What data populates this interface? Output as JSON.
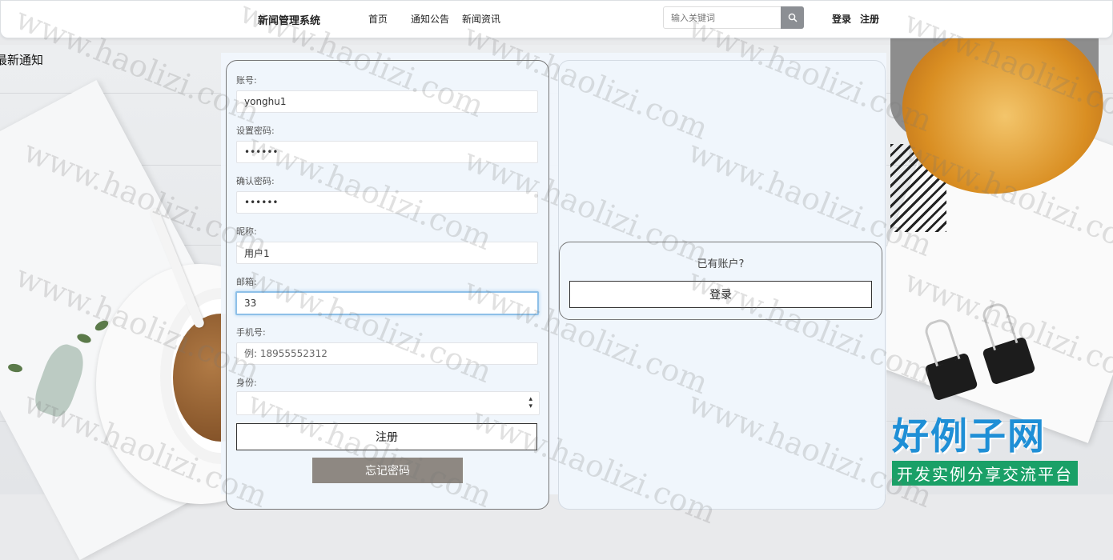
{
  "navbar": {
    "title": "新闻管理系统",
    "links": [
      "首页",
      "通知公告",
      "新闻资讯"
    ],
    "search_placeholder": "输入关键词",
    "login": "登录",
    "register": "注册"
  },
  "ticker": "最新通知",
  "form": {
    "account_label": "账号:",
    "account_value": "yonghu1",
    "password_label": "设置密码:",
    "password_value": "••••••",
    "confirm_label": "确认密码:",
    "confirm_value": "••••••",
    "nickname_label": "昵称:",
    "nickname_value": "用户1",
    "email_label": "邮箱:",
    "email_value": "33",
    "phone_label": "手机号:",
    "phone_placeholder": "例: 18955552312",
    "role_label": "身份:",
    "register_button": "注册",
    "forgot_button": "忘记密码"
  },
  "side": {
    "have_account": "已有账户?",
    "login_button": "登录"
  },
  "branding": {
    "title": "好例子网",
    "subtitle": "开发实例分享交流平台",
    "watermark": "www.haolizi.com"
  },
  "colors": {
    "panel": "#f0f6fc",
    "forgot_button": "#8e8882",
    "brand_blue": "#1f8fd6",
    "brand_green": "#1aa067"
  }
}
